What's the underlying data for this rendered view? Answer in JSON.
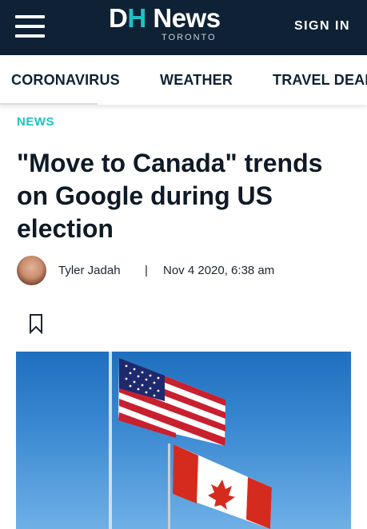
{
  "header": {
    "logo": {
      "main_left": "D",
      "main_mid": "H",
      "main_right": " News",
      "sub": "TORONTO"
    },
    "signin_label": "SIGN IN",
    "background": "#0f2135",
    "accent": "#1ec1c1"
  },
  "category_nav": {
    "items": [
      {
        "label": "CORONAVIRUS"
      },
      {
        "label": "WEATHER"
      },
      {
        "label": "TRAVEL DEALS"
      }
    ]
  },
  "article": {
    "section": "NEWS",
    "headline": "\"Move to Canada\" trends on Google during US election",
    "author": "Tyler Jadah",
    "separator": "|",
    "date": "Nov 4 2020, 6:38 am",
    "hero_image": {
      "description_icon": "flags-photo"
    }
  }
}
